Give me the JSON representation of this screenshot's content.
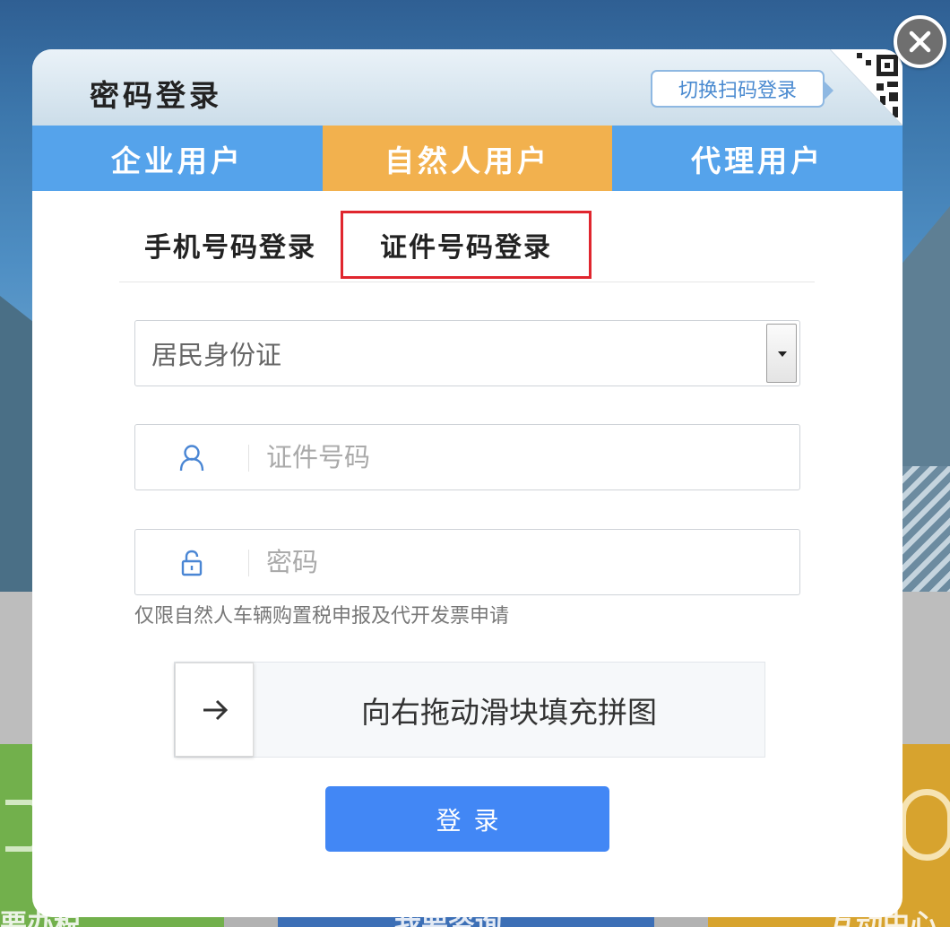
{
  "background": {
    "tile_labels": [
      "要办税",
      "我要咨询",
      "互动中心"
    ]
  },
  "dialog": {
    "title": "密码登录",
    "switch_button_label": "切换扫码登录",
    "close_icon": "close-icon",
    "qr_icon": "qr-code-icon"
  },
  "role_tabs": [
    {
      "label": "企业用户",
      "active": false
    },
    {
      "label": "自然人用户",
      "active": true
    },
    {
      "label": "代理用户",
      "active": false
    }
  ],
  "login_tabs": [
    {
      "label": "手机号码登录",
      "active": false
    },
    {
      "label": "证件号码登录",
      "active": true,
      "highlighted": true
    }
  ],
  "form": {
    "id_type": {
      "selected": "居民身份证"
    },
    "id_number": {
      "placeholder": "证件号码",
      "value": "",
      "icon": "user-icon"
    },
    "password": {
      "placeholder": "密码",
      "value": "",
      "icon": "lock-icon"
    },
    "note": "仅限自然人车辆购置税申报及代开发票申请"
  },
  "slider": {
    "instruction": "向右拖动滑块填充拼图",
    "handle_icon": "arrow-right-icon",
    "progress": 0
  },
  "login_button_label": "登录",
  "colors": {
    "tab_blue": "#55a3eb",
    "tab_active": "#f2b14e",
    "primary_button": "#4287f5",
    "highlight_border": "#e0262e"
  }
}
